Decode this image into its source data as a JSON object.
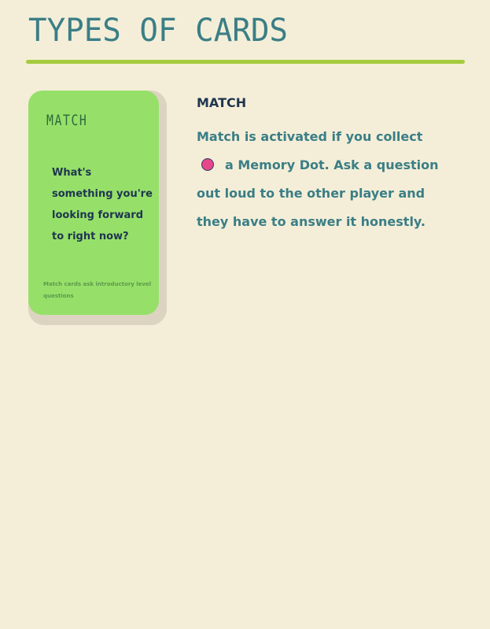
{
  "page": {
    "title": "TYPES OF CARDS"
  },
  "card": {
    "type_label": "MATCH",
    "question_lines": [
      "What's",
      "something you're",
      "looking forward",
      "to right now?"
    ],
    "footer": "Match cards ask introductory level questions"
  },
  "section": {
    "heading": "MATCH",
    "description": {
      "line1": "Match is activated if you collect",
      "line2": "a Memory Dot. Ask a question",
      "line3": "out loud to the other player and",
      "line4": "they have to answer it honestly."
    }
  },
  "icons": {
    "memory_dot": "memory-dot-icon"
  },
  "colors": {
    "background": "#f4eed8",
    "title": "#3a7e86",
    "rule": "#a4cc3c",
    "card": "#96e06a",
    "card_shadow": "#dcd4c0",
    "heading": "#1f3550",
    "description": "#3a7e86",
    "memory_dot": "#e8468c"
  }
}
